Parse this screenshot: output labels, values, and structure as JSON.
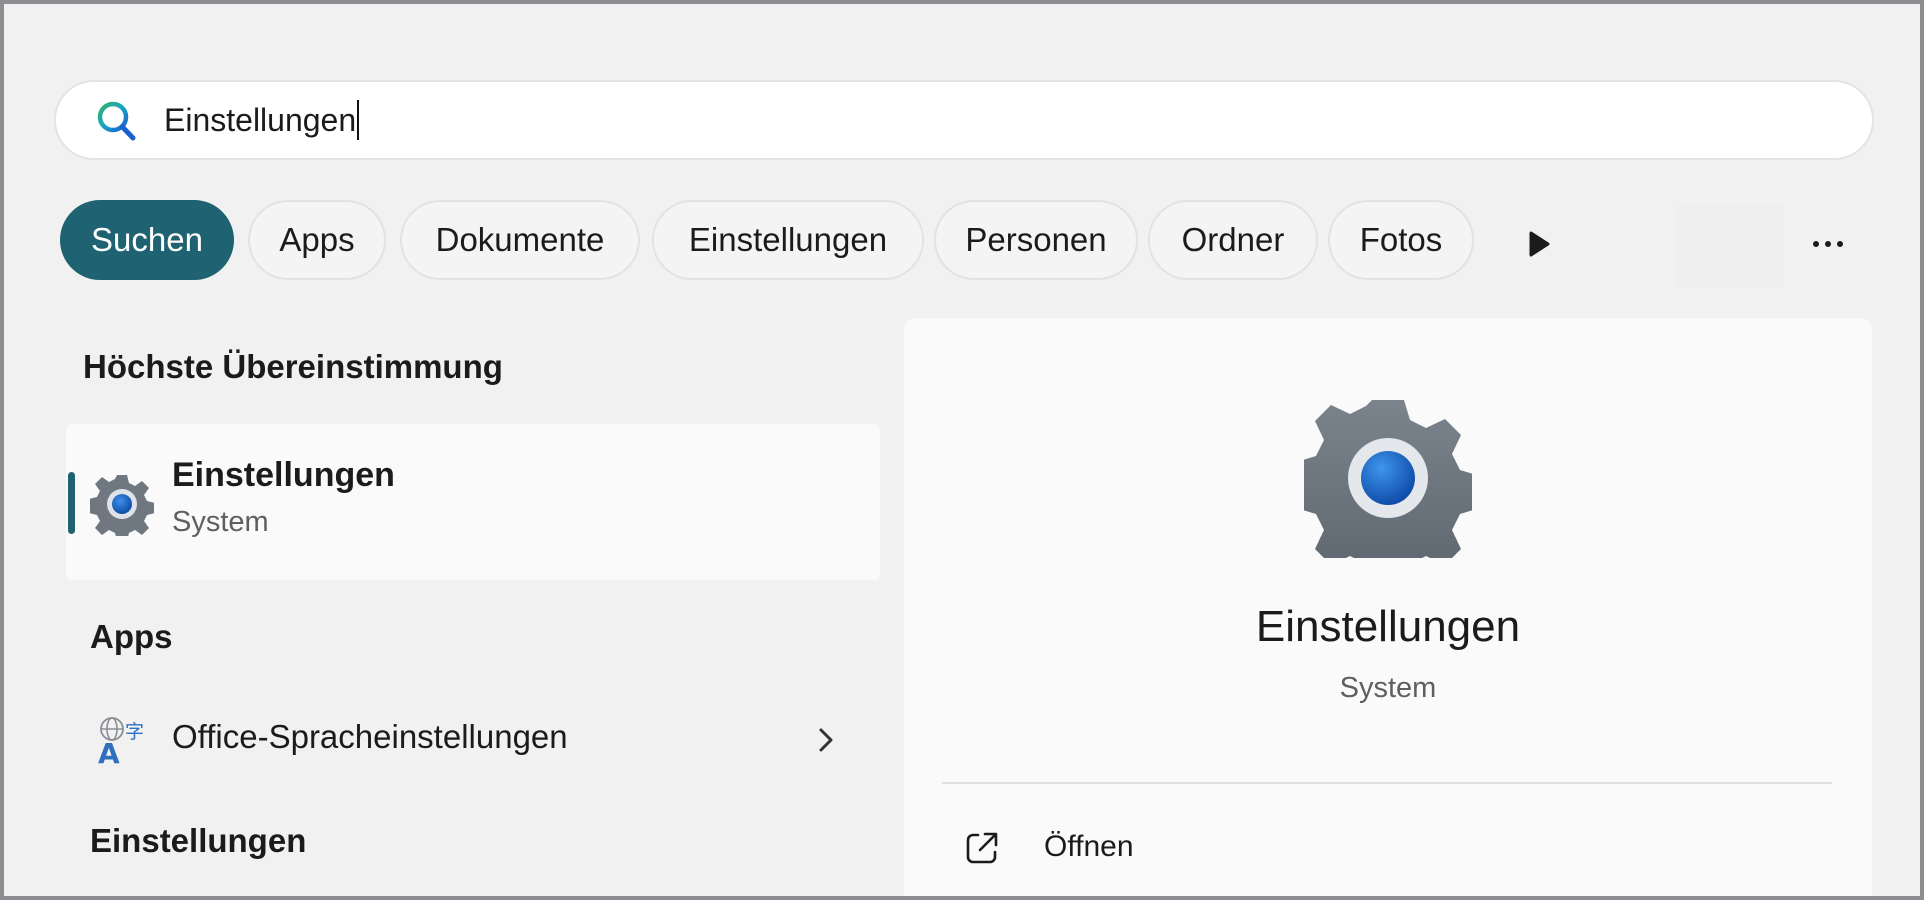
{
  "search": {
    "value": "Einstellungen"
  },
  "tabs": [
    {
      "label": "Suchen",
      "active": true
    },
    {
      "label": "Apps"
    },
    {
      "label": "Dokumente"
    },
    {
      "label": "Einstellungen"
    },
    {
      "label": "Personen"
    },
    {
      "label": "Ordner"
    },
    {
      "label": "Fotos"
    }
  ],
  "colors": {
    "accent": "#1f6271",
    "gear_blue": "#1058b8",
    "gear_gray": "#6e7782"
  },
  "best_match": {
    "heading": "Höchste Übereinstimmung",
    "title": "Einstellungen",
    "subtitle": "System"
  },
  "apps": {
    "heading": "Apps",
    "items": [
      {
        "label": "Office-Spracheinstellungen",
        "icon": "language-icon"
      }
    ]
  },
  "settings": {
    "heading": "Einstellungen"
  },
  "preview": {
    "title": "Einstellungen",
    "subtitle": "System",
    "actions": [
      {
        "label": "Öffnen",
        "icon": "open-external-icon"
      }
    ]
  }
}
